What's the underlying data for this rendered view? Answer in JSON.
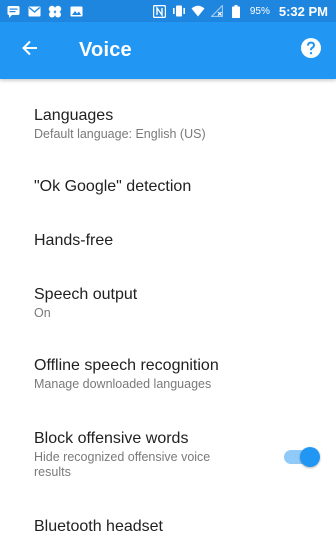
{
  "status_bar": {
    "left_icons": [
      "message-icon",
      "gmail-icon",
      "photos-icon",
      "image-icon"
    ],
    "right_icons": [
      "nfc-icon",
      "vibrate-icon",
      "wifi-icon",
      "no-signal-icon",
      "battery-icon"
    ],
    "battery_percent": "95%",
    "time": "5:32 PM"
  },
  "app_bar": {
    "title": "Voice",
    "back_icon": "arrow-back-icon",
    "help_icon": "help-icon"
  },
  "settings": {
    "languages": {
      "title": "Languages",
      "summary": "Default language: English (US)"
    },
    "ok_google": {
      "title": "\"Ok Google\" detection"
    },
    "hands_free": {
      "title": "Hands-free"
    },
    "speech_output": {
      "title": "Speech output",
      "summary": "On"
    },
    "offline": {
      "title": "Offline speech recognition",
      "summary": "Manage downloaded languages"
    },
    "block_offensive": {
      "title": "Block offensive words",
      "summary": "Hide recognized offensive voice results",
      "toggle_on": true
    },
    "bluetooth": {
      "title": "Bluetooth headset"
    }
  },
  "colors": {
    "status_bar": "#1f86e0",
    "app_bar": "#2196f3",
    "accent": "#2196f3",
    "toggle_track": "#90caf9",
    "title_text": "#212121",
    "summary_text": "#7a7a7a"
  }
}
